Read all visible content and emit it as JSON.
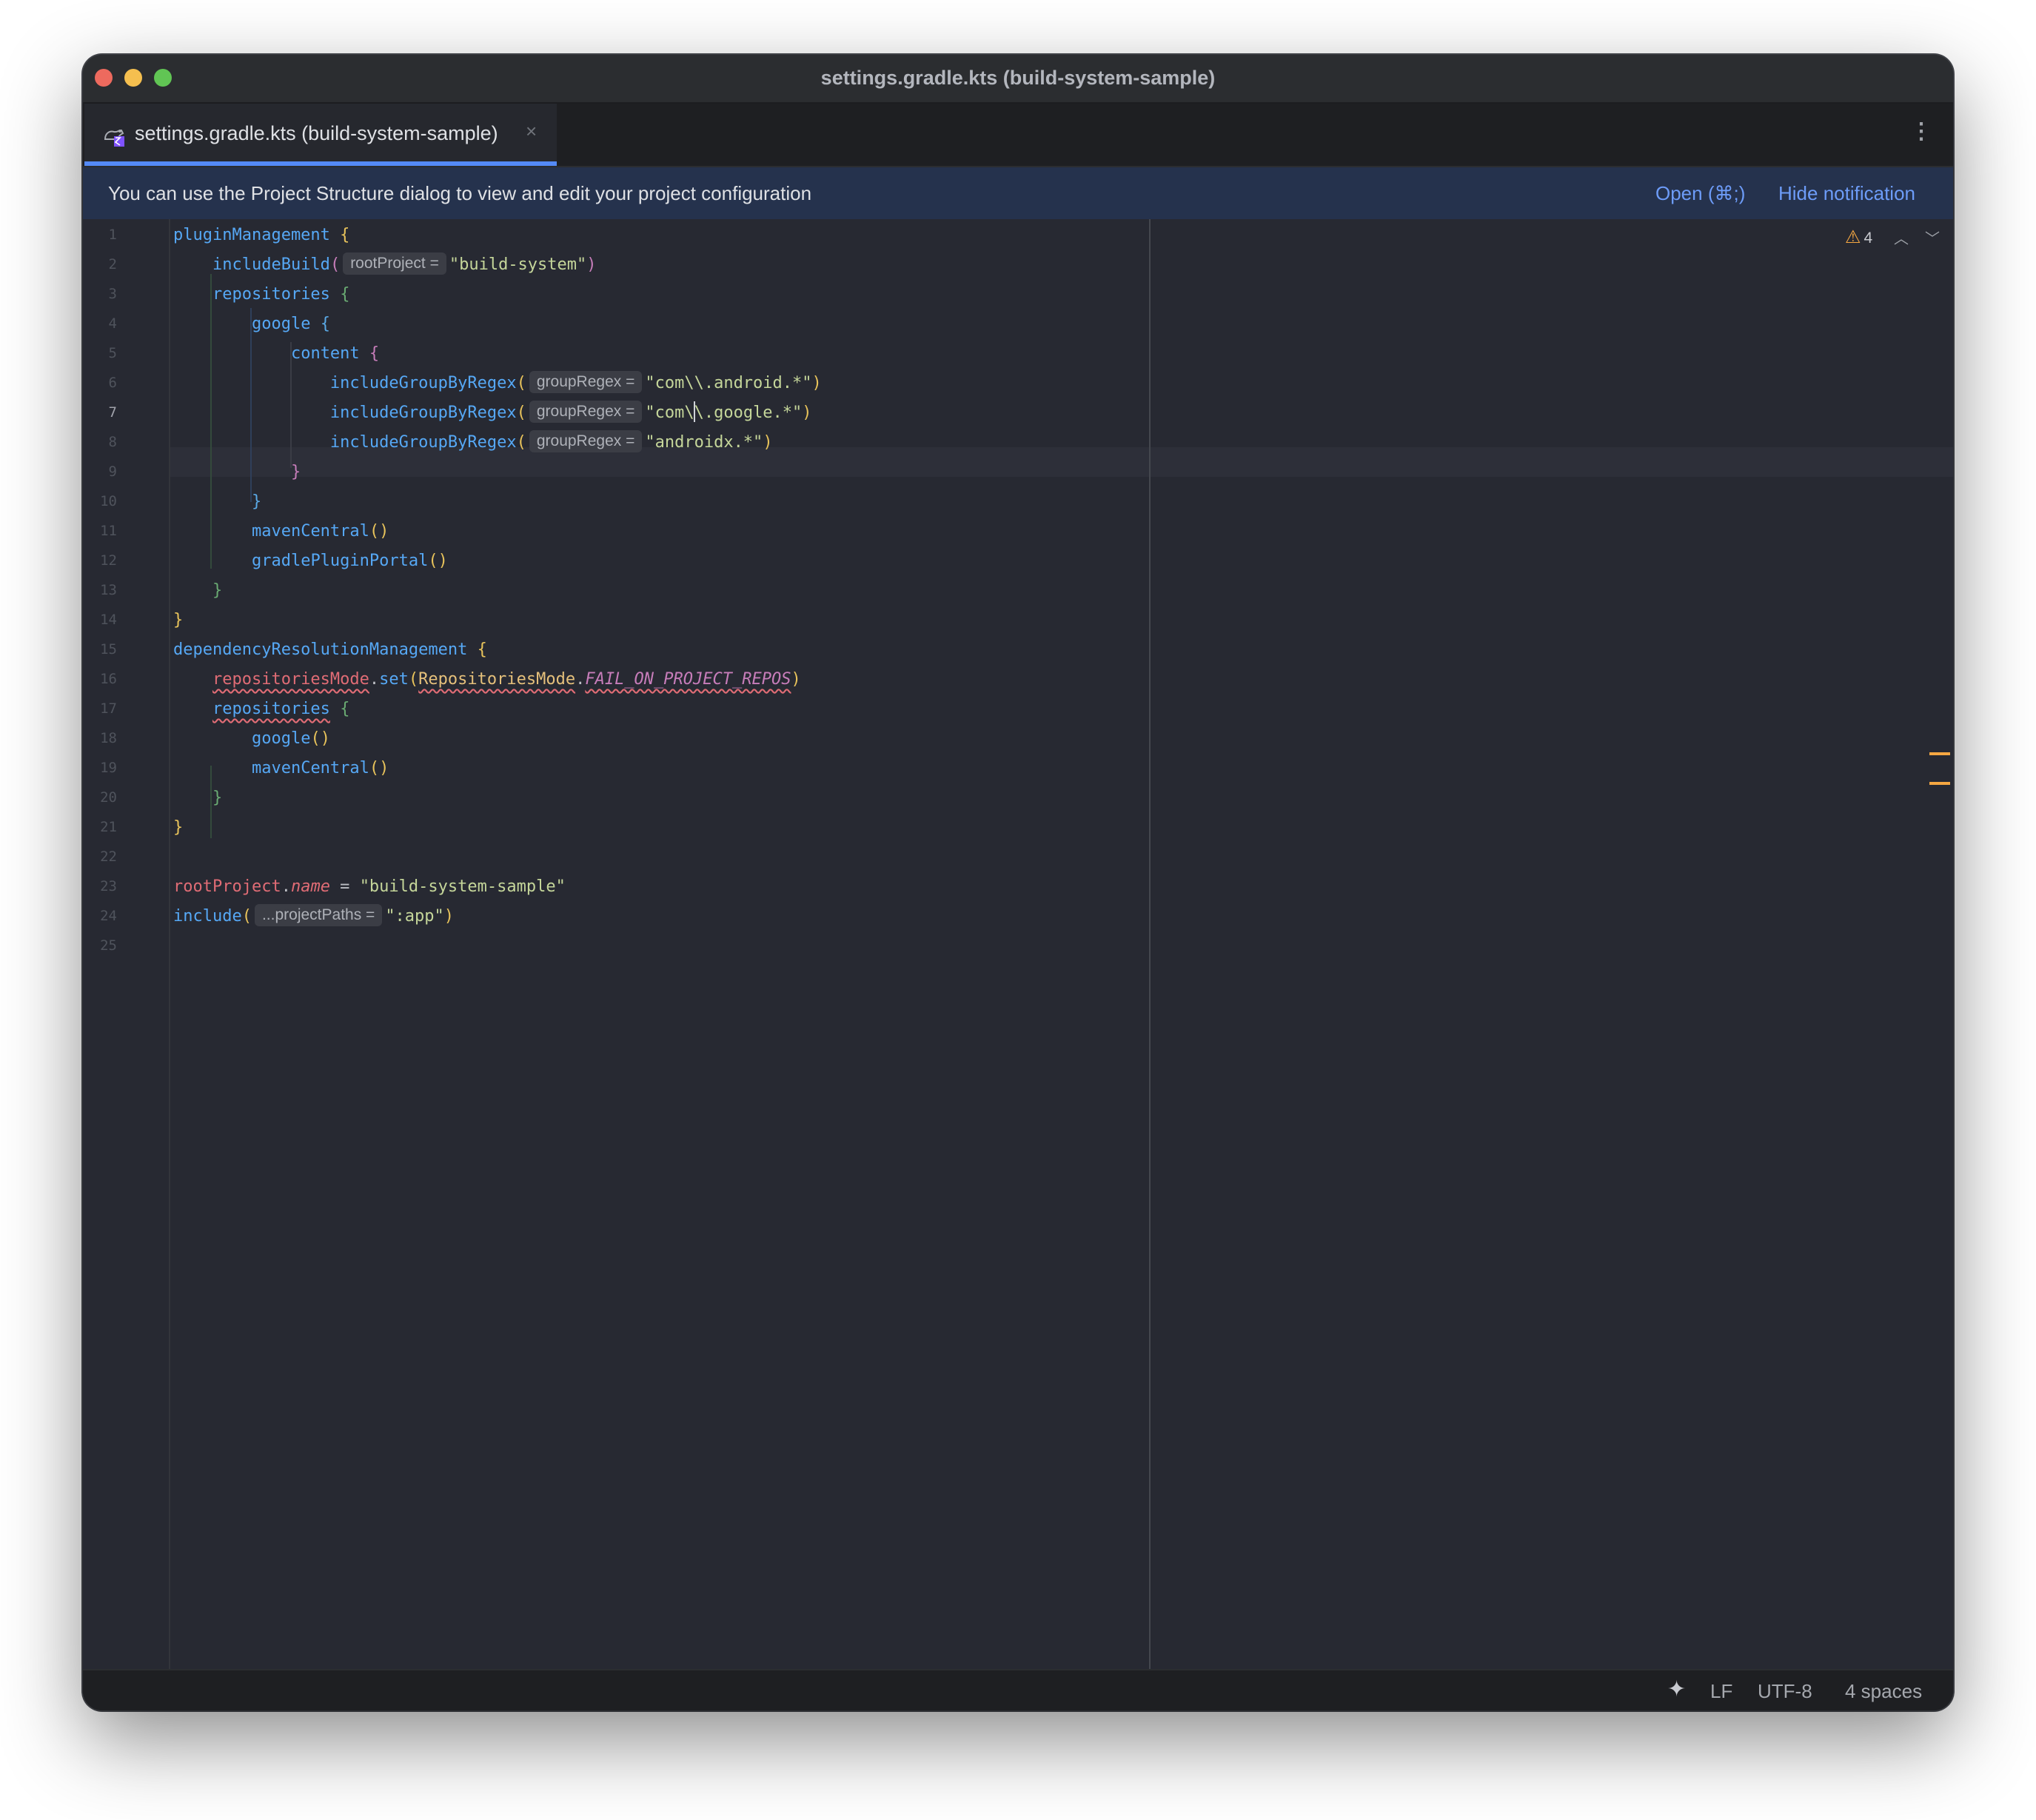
{
  "window": {
    "title": "settings.gradle.kts (build-system-sample)"
  },
  "tab": {
    "label": "settings.gradle.kts (build-system-sample)",
    "close": "×",
    "icon": "gradle-kotlin-file-icon"
  },
  "toolbar": {
    "more": "⋮"
  },
  "notification": {
    "text": "You can use the Project Structure dialog to view and edit your project configuration",
    "open_label": "Open (⌘;)",
    "hide_label": "Hide notification"
  },
  "inspections": {
    "warning_icon": "⚠",
    "warning_count": "4",
    "prev": "︿",
    "next": "﹀"
  },
  "editor": {
    "current_line": 7,
    "line_numbers": [
      "1",
      "2",
      "3",
      "4",
      "5",
      "6",
      "7",
      "8",
      "9",
      "10",
      "11",
      "12",
      "13",
      "14",
      "15",
      "16",
      "17",
      "18",
      "19",
      "20",
      "21",
      "22",
      "23",
      "24",
      "25"
    ],
    "lines": {
      "l1": {
        "fn": "pluginManagement",
        "brace": "{"
      },
      "l2": {
        "fn": "includeBuild",
        "open": "(",
        "hint": "rootProject =",
        "str": "\"build-system\"",
        "close": ")"
      },
      "l3": {
        "fn": "repositories",
        "brace": "{"
      },
      "l4": {
        "fn": "google",
        "brace": "{"
      },
      "l5": {
        "fn": "content",
        "brace": "{"
      },
      "l6": {
        "fn": "includeGroupByRegex",
        "open": "(",
        "hint": "groupRegex =",
        "str": "\"com\\\\.android.*\"",
        "close": ")"
      },
      "l7": {
        "fn": "includeGroupByRegex",
        "open": "(",
        "hint": "groupRegex =",
        "str_a": "\"com\\",
        "str_b": "\\.google.*\"",
        "close": ")"
      },
      "l8": {
        "fn": "includeGroupByRegex",
        "open": "(",
        "hint": "groupRegex =",
        "str": "\"androidx.*\"",
        "close": ")"
      },
      "l9": {
        "brace": "}"
      },
      "l10": {
        "brace": "}"
      },
      "l11": {
        "fn": "mavenCentral",
        "parens": "()"
      },
      "l12": {
        "fn": "gradlePluginPortal",
        "parens": "()"
      },
      "l13": {
        "brace": "}"
      },
      "l14": {
        "brace": "}"
      },
      "l15": {
        "fn": "dependencyResolutionManagement",
        "brace": "{"
      },
      "l16": {
        "prop": "repositoriesMode",
        "dot": ".",
        "fn": "set",
        "open": "(",
        "cls": "RepositoriesMode",
        "dot2": ".",
        "const": "FAIL_ON_PROJECT_REPOS",
        "close": ")"
      },
      "l17": {
        "fn": "repositories",
        "brace": "{"
      },
      "l18": {
        "fn": "google",
        "parens": "()"
      },
      "l19": {
        "fn": "mavenCentral",
        "parens": "()"
      },
      "l20": {
        "brace": "}"
      },
      "l21": {
        "brace": "}"
      },
      "l23": {
        "obj": "rootProject",
        "dot": ".",
        "prop": "name",
        "eq": " = ",
        "str": "\"build-system-sample\""
      },
      "l24": {
        "fn": "include",
        "open": "(",
        "hint": "...projectPaths =",
        "str": "\":app\"",
        "close": ")"
      }
    }
  },
  "statusbar": {
    "ai": "✦",
    "line_sep": "LF",
    "encoding": "UTF-8",
    "indent": "4 spaces"
  }
}
